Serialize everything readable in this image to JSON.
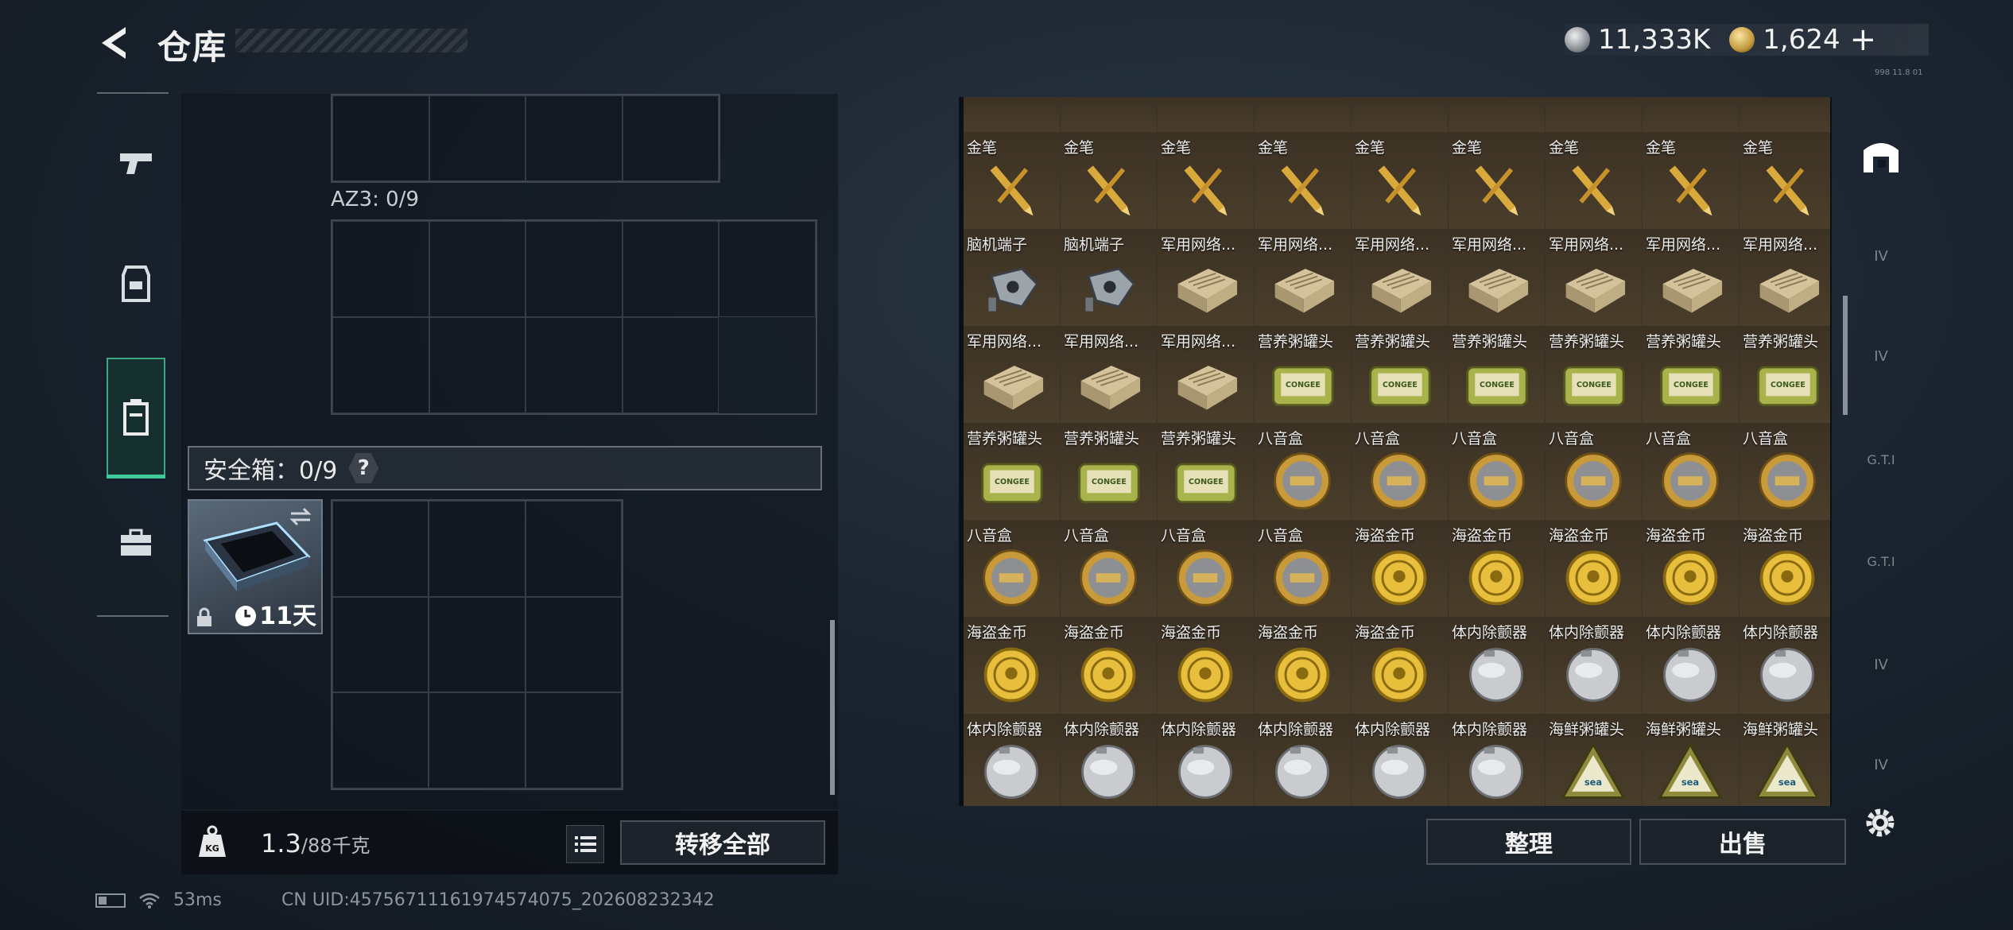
{
  "header": {
    "title": "仓库",
    "currency_silver": "11,333K",
    "currency_gold": "1,624",
    "add_label": "+",
    "version": "998 11.8 01"
  },
  "left_panel": {
    "az3_label": "AZ3: 0/9",
    "safe_label": "安全箱：0/9",
    "safe_help": "?",
    "safe_item_days": "11天"
  },
  "bottom_left": {
    "weight_current": "1.3",
    "weight_max": "/88千克",
    "transfer_label": "转移全部"
  },
  "actions": {
    "sort_label": "整理",
    "sell_label": "出售"
  },
  "status_bar": {
    "ping": "53ms",
    "uid": "CN UID:457567111619745740​75_202608232342"
  },
  "items": {
    "rows": [
      [
        "金笔",
        "金笔",
        "金笔",
        "金笔",
        "金笔",
        "金笔",
        "金笔",
        "金笔",
        "金笔"
      ],
      [
        "脑机端子",
        "脑机端子",
        "军用网络...",
        "军用网络...",
        "军用网络...",
        "军用网络...",
        "军用网络...",
        "军用网络...",
        "军用网络..."
      ],
      [
        "军用网络...",
        "军用网络...",
        "军用网络...",
        "营养粥罐头",
        "营养粥罐头",
        "营养粥罐头",
        "营养粥罐头",
        "营养粥罐头",
        "营养粥罐头"
      ],
      [
        "营养粥罐头",
        "营养粥罐头",
        "营养粥罐头",
        "八音盒",
        "八音盒",
        "八音盒",
        "八音盒",
        "八音盒",
        "八音盒"
      ],
      [
        "八音盒",
        "八音盒",
        "八音盒",
        "八音盒",
        "海盗金币",
        "海盗金币",
        "海盗金币",
        "海盗金币",
        "海盗金币"
      ],
      [
        "海盗金币",
        "海盗金币",
        "海盗金币",
        "海盗金币",
        "海盗金币",
        "体内除颤器",
        "体内除颤器",
        "体内除颤器",
        "体内除颤器"
      ],
      [
        "体内除颤器",
        "体内除颤器",
        "体内除颤器",
        "体内除颤器",
        "体内除颤器",
        "体内除颤器",
        "海鲜粥罐头",
        "海鲜粥罐头",
        "海鲜粥罐头"
      ]
    ]
  },
  "right_sidebar": {
    "tabs": [
      "IV",
      "IV",
      "G.T.I",
      "G.T.I",
      "IV",
      "IV"
    ]
  }
}
